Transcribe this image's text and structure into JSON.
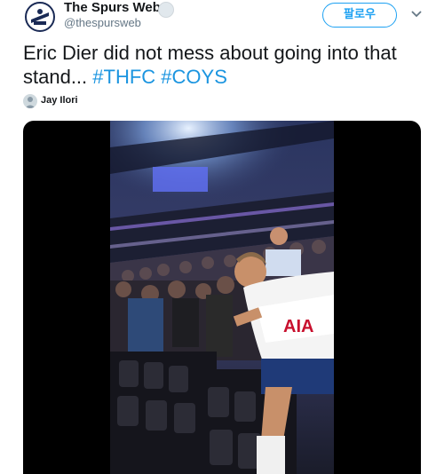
{
  "account": {
    "display_name": "The Spurs Web",
    "handle": "@thespursweb",
    "avatar_icon": "spurs-web-logo-icon"
  },
  "follow_button": {
    "label": "팔로우"
  },
  "tweet": {
    "text_prefix": "Eric Dier did not mess about going into that stand... ",
    "hashtags": [
      "#THFC",
      "#COYS"
    ]
  },
  "attribution": {
    "name": "Jay Ilori"
  },
  "media": {
    "kind": "video",
    "jersey_text": "AIA"
  },
  "colors": {
    "link": "#1b95e0",
    "follow": "#1da1f2",
    "text": "#14171a",
    "muted": "#657786"
  }
}
